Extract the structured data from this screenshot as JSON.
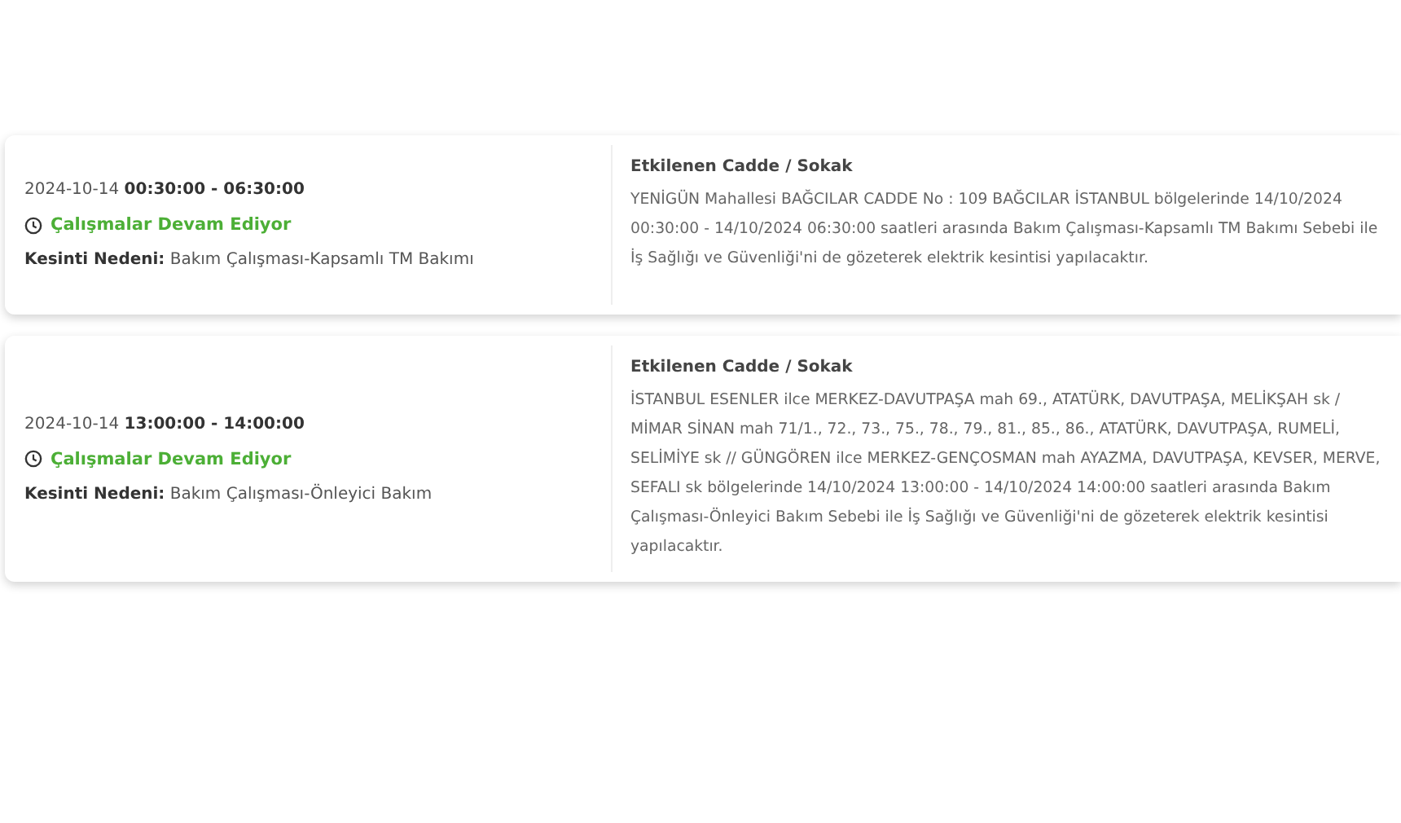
{
  "outages": [
    {
      "date_time": "2024-10-14 **00:30:00 - 06:30:00**",
      "status": "Çalışmalar Devam Ediyor",
      "reason": "**Kesinti Nedeni:** Bakım Çalışması-Kapsamlı TM Bakımı",
      "streets_heading": "Etkilenen Cadde / Sokak",
      "streets_text": "YENİGÜN Mahallesi BAĞCILAR CADDE No : 109 BAĞCILAR İSTANBUL bölgelerinde 14/10/2024 00:30:00 - 14/10/2024 06:30:00 saatleri arasında Bakım Çalışması-Kapsamlı TM Bakımı Sebebi ile İş Sağlığı ve Güvenliği'ni de gözeterek elektrik kesintisi yapılacaktır."
    },
    {
      "date_time": "2024-10-14 **13:00:00 - 14:00:00**",
      "status": "Çalışmalar Devam Ediyor",
      "reason": "**Kesinti Nedeni:** Bakım Çalışması-Önleyici Bakım",
      "streets_heading": "Etkilenen Cadde / Sokak",
      "streets_text": "İSTANBUL ESENLER ilce MERKEZ-DAVUTPAŞA mah 69., ATATÜRK, DAVUTPAŞA, MELİKŞAH sk / MİMAR SİNAN mah 71/1., 72., 73., 75., 78., 79., 81., 85., 86., ATATÜRK, DAVUTPAŞA, RUMELİ, SELİMİYE sk // GÜNGÖREN ilce MERKEZ-GENÇOSMAN mah AYAZMA, DAVUTPAŞA, KEVSER, MERVE, SEFALI sk bölgelerinde 14/10/2024 13:00:00 - 14/10/2024 14:00:00 saatleri arasında Bakım Çalışması-Önleyici Bakım Sebebi ile İş Sağlığı ve Güvenliği'ni de gözeterek elektrik kesintisi yapılacaktır."
    }
  ]
}
